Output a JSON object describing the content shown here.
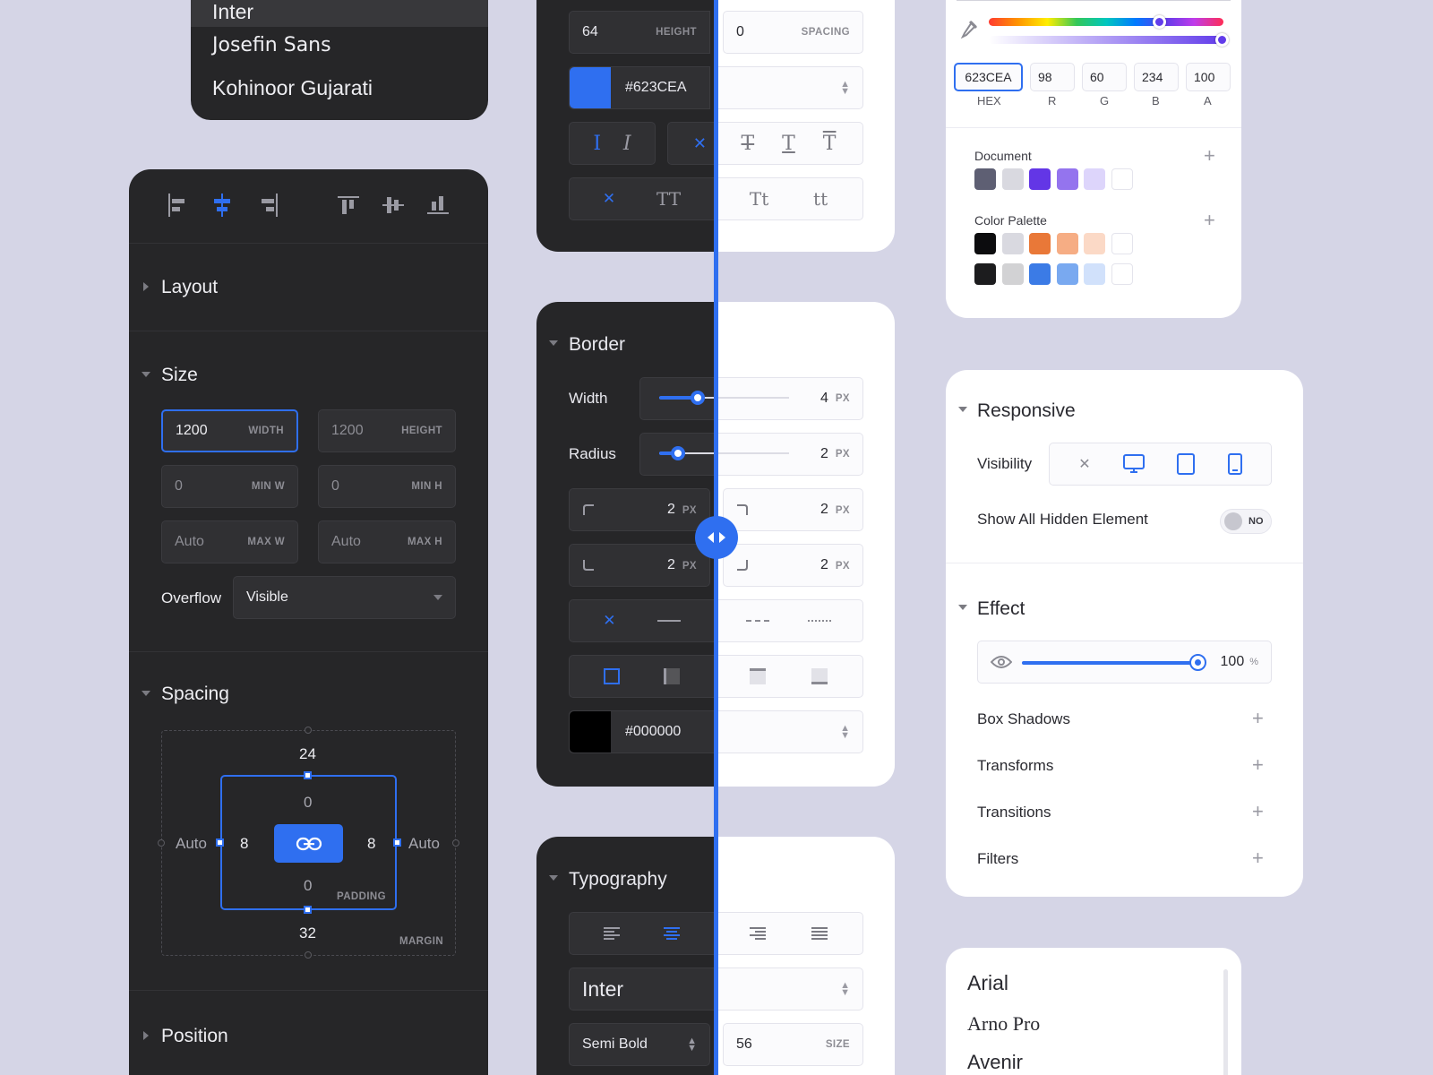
{
  "font_menu_top": {
    "items": [
      "Inter",
      "Josefin Sans",
      "Kohinoor Gujarati"
    ]
  },
  "left_panel": {
    "layout": {
      "title": "Layout"
    },
    "size": {
      "title": "Size",
      "width": "1200",
      "width_label": "WIDTH",
      "height": "1200",
      "height_label": "HEIGHT",
      "minw": "0",
      "minw_label": "MIN W",
      "minh": "0",
      "minh_label": "MIN H",
      "maxw": "Auto",
      "maxw_label": "MAX W",
      "maxh": "Auto",
      "maxh_label": "MAX H",
      "overflow_label": "Overflow",
      "overflow_value": "Visible"
    },
    "spacing": {
      "title": "Spacing",
      "margin_top": "24",
      "margin_bottom": "32",
      "margin_left": "Auto",
      "margin_right": "Auto",
      "padding_top": "0",
      "padding_bottom": "0",
      "padding_left": "8",
      "padding_right": "8",
      "padding_label": "PADDING",
      "margin_label": "MARGIN"
    },
    "position": {
      "title": "Position"
    }
  },
  "text_panel": {
    "height": "64",
    "height_label": "HEIGHT",
    "spacing": "0",
    "spacing_label": "SPACING",
    "color_hex": "#623CEA",
    "tt1": "TT",
    "tt2": "Tt",
    "tt3": "tt"
  },
  "border_panel": {
    "title": "Border",
    "width_label": "Width",
    "width_value": "4",
    "radius_label": "Radius",
    "radius_value": "2",
    "unit": "PX",
    "corner_tl": "2",
    "corner_tr": "2",
    "corner_bl": "2",
    "corner_br": "2",
    "color_hex": "#000000"
  },
  "typography_panel": {
    "title": "Typography",
    "font": "Inter",
    "weight": "Semi Bold",
    "size": "56",
    "size_label": "SIZE"
  },
  "color_picker": {
    "hex": "623CEA",
    "r": "98",
    "g": "60",
    "b": "234",
    "a": "100",
    "hex_label": "HEX",
    "r_label": "R",
    "g_label": "G",
    "b_label": "B",
    "a_label": "A",
    "document_label": "Document",
    "palette_label": "Color Palette",
    "colors": {
      "document": [
        "#5e5f73",
        "#d9d9e0",
        "#6336e6",
        "#9474ee",
        "#ddd5fb",
        "#ffffff"
      ],
      "palette1": [
        "#0c0c0e",
        "#d9d9e0",
        "#e97838",
        "#f6ad84",
        "#fbd9c6",
        "#ffffff"
      ],
      "palette2": [
        "#1c1c1e",
        "#d2d2d4",
        "#3b7be6",
        "#79a9f0",
        "#d1e1fb",
        "#ffffff"
      ]
    }
  },
  "responsive_panel": {
    "title": "Responsive",
    "visibility_label": "Visibility",
    "hidden_label": "Show All Hidden Element",
    "toggle_value": "NO",
    "effect_title": "Effect",
    "opacity": "100",
    "opacity_unit": "%",
    "box_shadows": "Box Shadows",
    "transforms": "Transforms",
    "transitions": "Transitions",
    "filters": "Filters"
  },
  "font_list": {
    "items": [
      "Arial",
      "Arno Pro",
      "Avenir"
    ]
  },
  "accent": "#2f6ff0"
}
